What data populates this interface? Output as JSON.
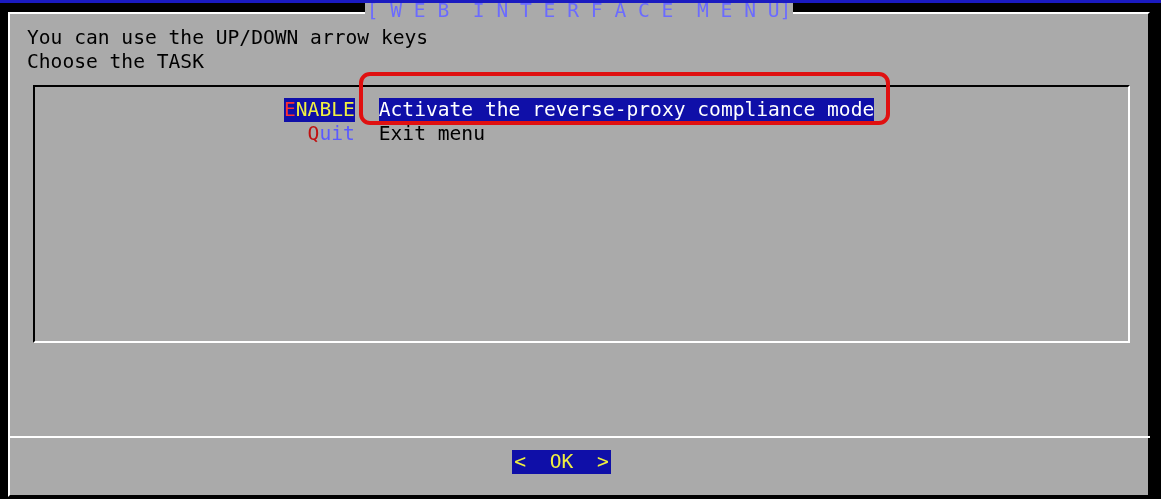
{
  "dialog": {
    "title": "[ W E B  I N T E R F A C E  M E N U]",
    "prompt": [
      "You can use the UP/DOWN arrow keys",
      "Choose the TASK"
    ],
    "menu": [
      {
        "tag": "ENABLE",
        "description": "Activate the reverse-proxy compliance mode",
        "selected": true
      },
      {
        "tag": "Quit",
        "description": "Exit menu",
        "selected": false
      }
    ],
    "buttons": [
      {
        "label": "<  OK  >",
        "selected": true
      }
    ]
  }
}
